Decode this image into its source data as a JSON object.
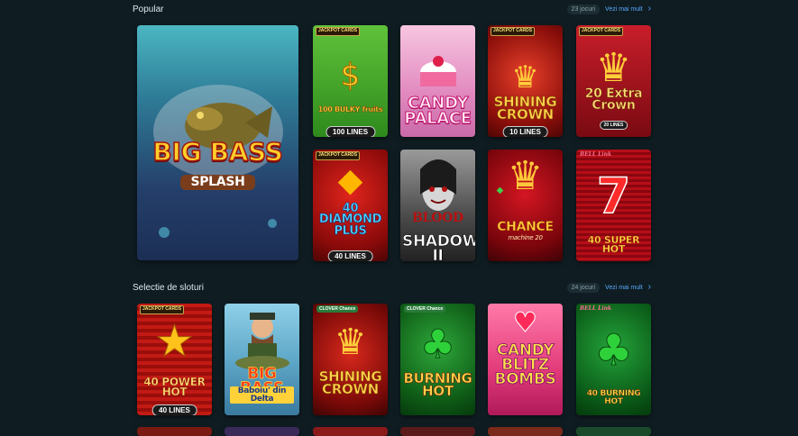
{
  "popular": {
    "title": "Popular",
    "count": "23 jocuri",
    "see_more": "Vezi mai mult",
    "games": [
      {
        "title": "BIG BASS",
        "subtitle": "SPLASH"
      },
      {
        "title": "100 BULKY fruits",
        "lines": "100 LINES",
        "badge": "JACKPOT CARDS"
      },
      {
        "title": "CANDY PALACE"
      },
      {
        "title": "SHINING CROWN",
        "lines": "10 LINES",
        "badge": "JACKPOT CARDS"
      },
      {
        "title": "20 Extra Crown",
        "lines": "20 LINES",
        "badge": "JACKPOT CARDS"
      },
      {
        "title": "40 DIAMOND PLUS",
        "lines": "40 LINES",
        "badge": "JACKPOT CARDS"
      },
      {
        "title": "BLOOD",
        "subtitle": "SHADOW II"
      },
      {
        "title": "CHANCE",
        "subtitle": "machine 20"
      },
      {
        "title": "40 SUPER HOT",
        "badge": "BELL Link"
      }
    ]
  },
  "selection": {
    "title": "Selectie de sloturi",
    "count": "24 jocuri",
    "see_more": "Vezi mai mult",
    "games": [
      {
        "title": "40 POWER HOT",
        "lines": "40 LINES",
        "badge": "JACKPOT CARDS"
      },
      {
        "title": "BIG BASS",
        "subtitle": "Baboiu' din Delta"
      },
      {
        "title": "SHINING CROWN",
        "badge": "CLOVER Chance"
      },
      {
        "title": "BURNING HOT",
        "badge": "CLOVER Chance"
      },
      {
        "title": "CANDY BLITZ BOMBS"
      },
      {
        "title": "40 BURNING HOT",
        "badge": "BELL Link"
      }
    ]
  }
}
